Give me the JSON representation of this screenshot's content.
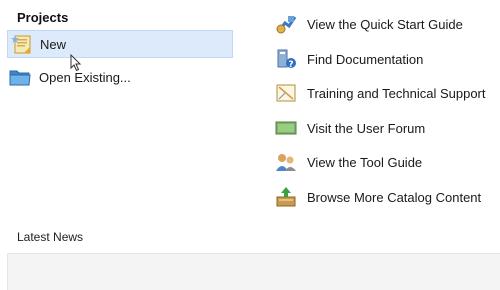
{
  "projects": {
    "title": "Projects",
    "items": [
      {
        "label": "New",
        "icon": "new-project-icon",
        "selected": true
      },
      {
        "label": "Open Existing...",
        "icon": "folder-icon",
        "selected": false
      }
    ]
  },
  "resources": [
    {
      "label": "View the Quick Start Guide",
      "icon": "quick-start-icon"
    },
    {
      "label": "Find Documentation",
      "icon": "documentation-icon"
    },
    {
      "label": "Training and Technical Support",
      "icon": "training-icon"
    },
    {
      "label": "Visit the User Forum",
      "icon": "forum-icon"
    },
    {
      "label": "View the Tool Guide",
      "icon": "tool-guide-icon"
    },
    {
      "label": "Browse More Catalog Content",
      "icon": "catalog-icon"
    }
  ],
  "news": {
    "title": "Latest News"
  },
  "colors": {
    "selection": "#dceafb",
    "selection_border": "#c3d9f3",
    "news_background": "#f4f4f4"
  }
}
